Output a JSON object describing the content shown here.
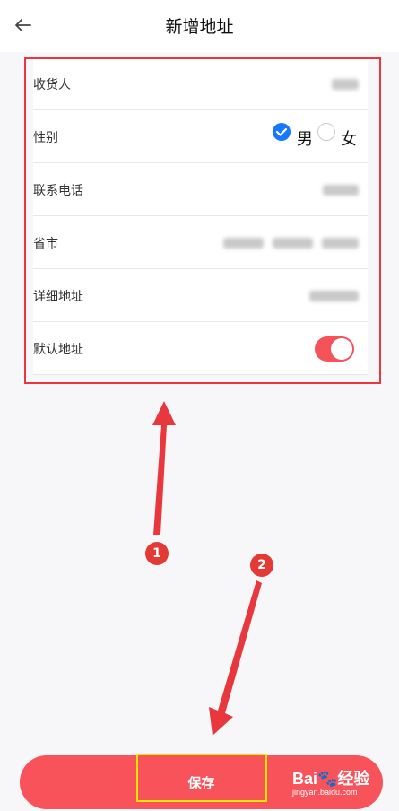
{
  "header": {
    "title": "新增地址"
  },
  "form": {
    "recipient": {
      "label": "收货人"
    },
    "gender": {
      "label": "性别",
      "options": [
        "男",
        "女"
      ],
      "selected": "男"
    },
    "phone": {
      "label": "联系电话"
    },
    "region": {
      "label": "省市"
    },
    "address": {
      "label": "详细地址"
    },
    "default": {
      "label": "默认地址",
      "enabled": true
    }
  },
  "annotations": {
    "badge1": "1",
    "badge2": "2"
  },
  "save": {
    "label": "保存"
  },
  "watermark": {
    "main": "Bai🐾经验",
    "sub": "jingyan.baidu.com"
  },
  "colors": {
    "accent": "#f8525a",
    "annotation_red": "#e8383d",
    "highlight_yellow": "#f5e500",
    "radio_blue": "#1677ff"
  }
}
